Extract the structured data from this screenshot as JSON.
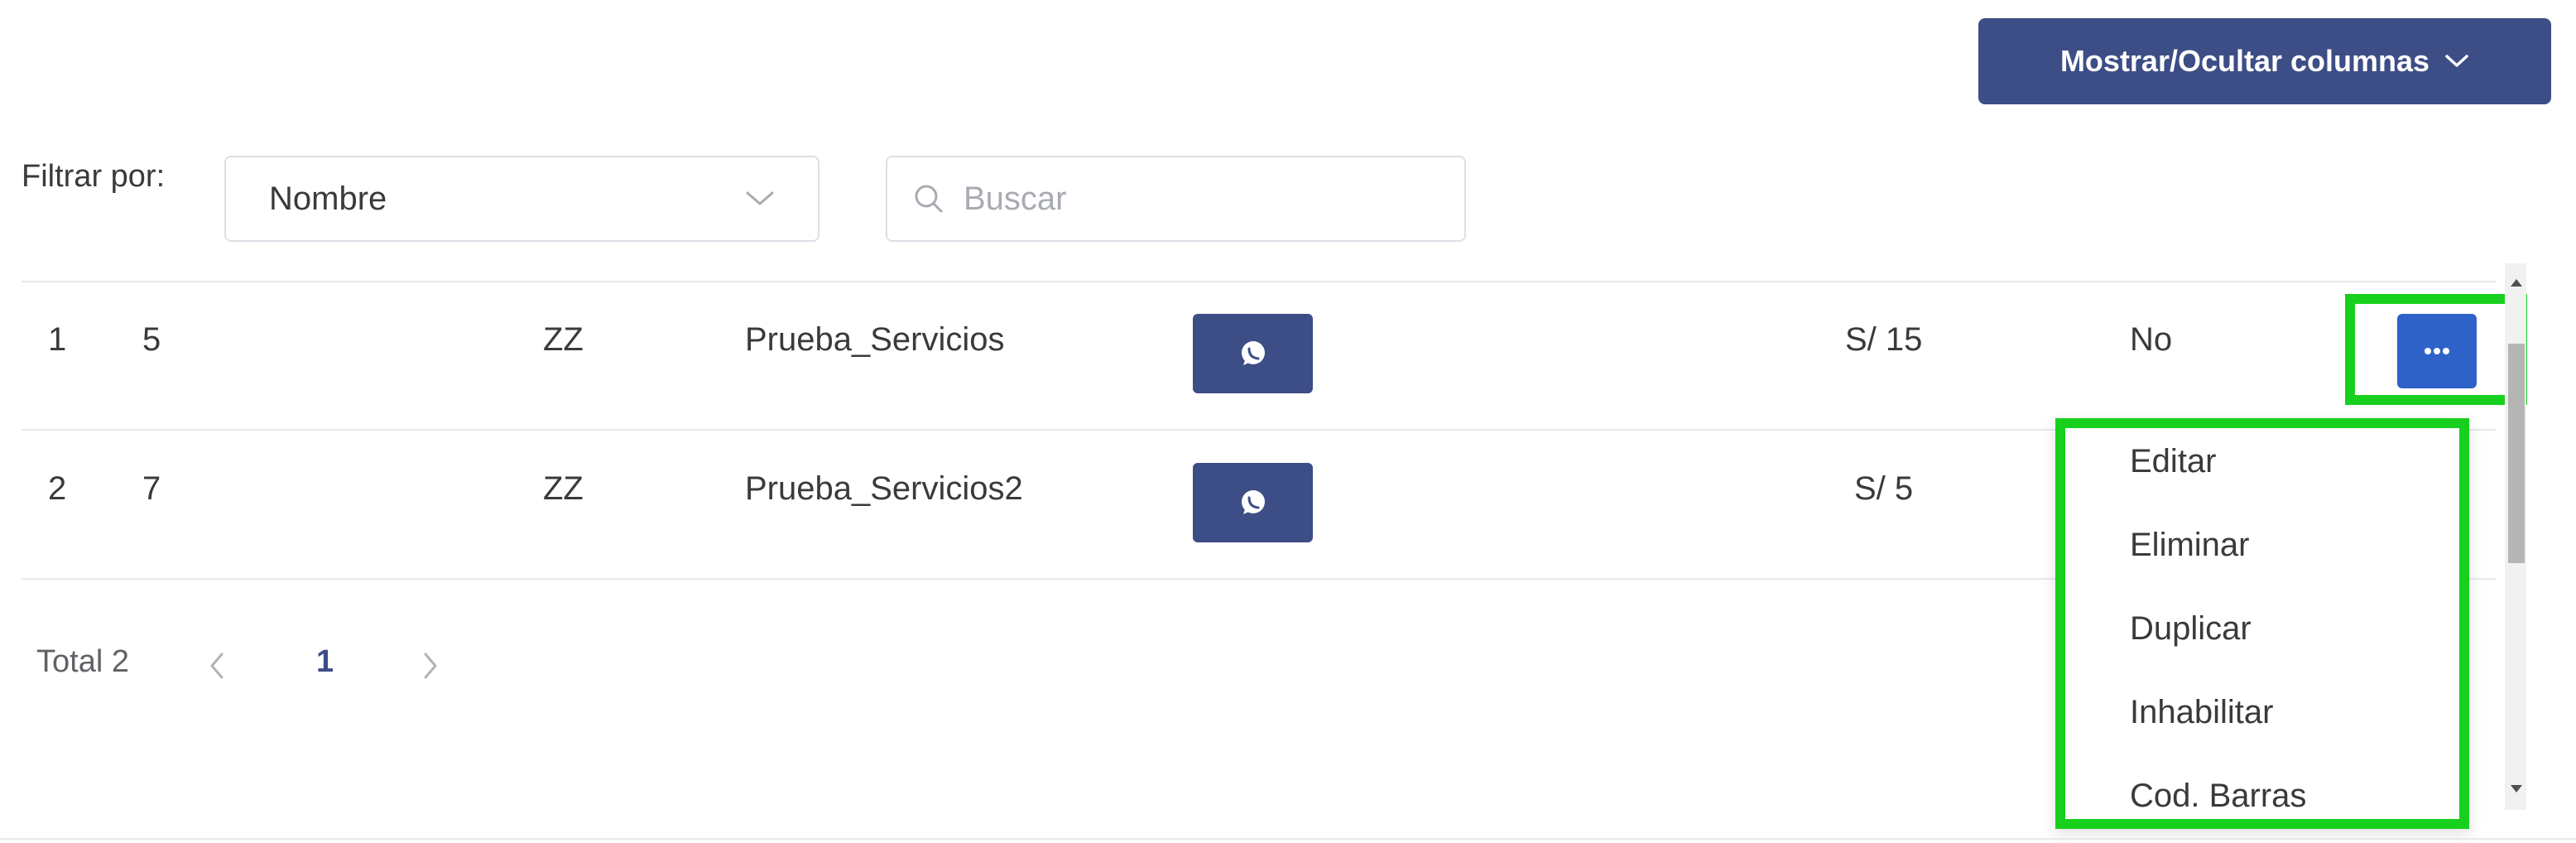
{
  "toolbar": {
    "columns_button_label": "Mostrar/Ocultar columnas"
  },
  "filter": {
    "label": "Filtrar por:",
    "selected": "Nombre",
    "search_placeholder": "Buscar"
  },
  "rows": [
    {
      "index": "1",
      "id": "5",
      "code": "ZZ",
      "name": "Prueba_Servicios",
      "price": "S/ 15",
      "flag": "No"
    },
    {
      "index": "2",
      "id": "7",
      "code": "ZZ",
      "name": "Prueba_Servicios2",
      "price": "S/ 5",
      "flag": ""
    }
  ],
  "actions_menu": {
    "items": [
      "Editar",
      "Eliminar",
      "Duplicar",
      "Inhabilitar",
      "Cod. Barras"
    ]
  },
  "pagination": {
    "total": "Total 2",
    "current_page": "1"
  },
  "colors": {
    "primary": "#3d4d86",
    "action_blue": "#2f62c9",
    "highlight_green": "#17d01e"
  },
  "icons": {
    "dropdown": "chevron-down-icon",
    "search": "search-icon",
    "whatsapp": "whatsapp-icon",
    "more": "more-horizontal-icon"
  }
}
